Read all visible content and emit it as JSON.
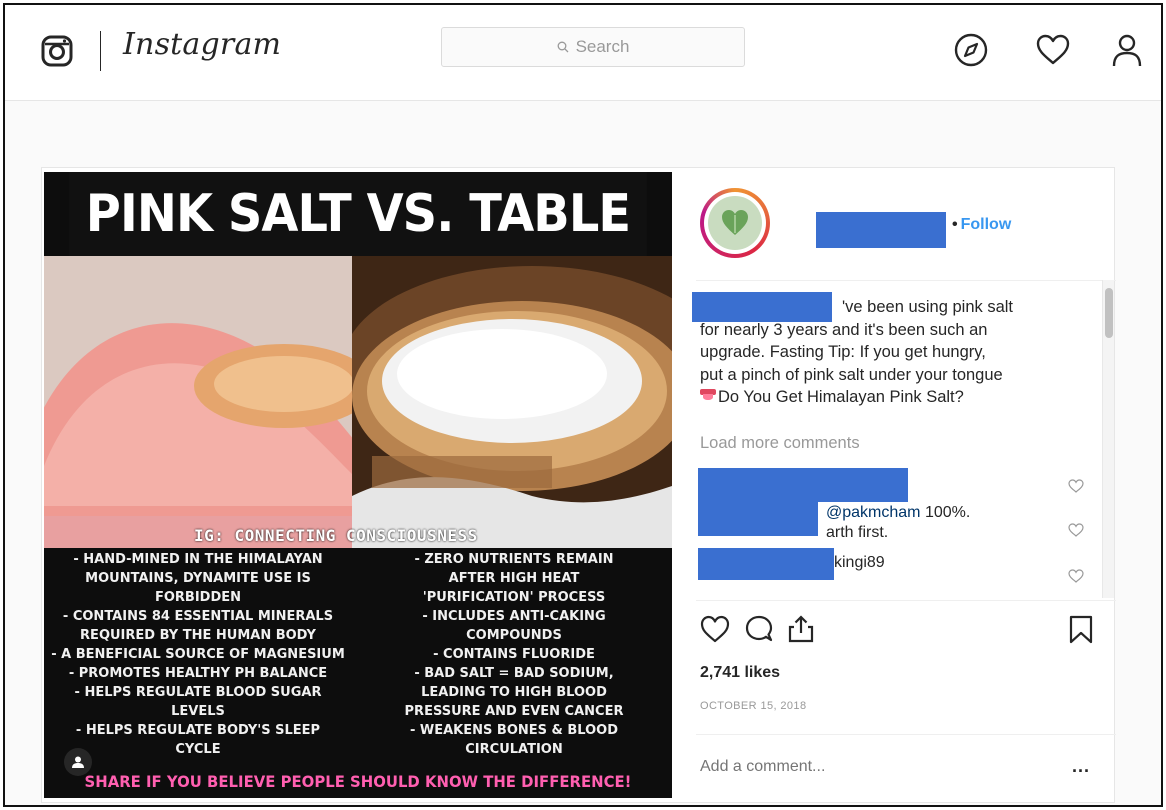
{
  "header": {
    "wordmark": "Instagram",
    "search_placeholder": "Search",
    "icons": [
      "instagram-glyph-icon",
      "compass-icon",
      "heart-icon",
      "profile-icon"
    ]
  },
  "post": {
    "image": {
      "title": "PINK SALT VS. TABLE SALT",
      "credit": "IG: CONNECTING CONSCIOUSNESS",
      "left_points": "- HAND-MINED IN THE HIMALAYAN\nMOUNTAINS, DYNAMITE USE IS\nFORBIDDEN\n- CONTAINS 84 ESSENTIAL MINERALS\nREQUIRED BY THE HUMAN BODY\n- A BENEFICIAL SOURCE OF MAGNESIUM\n- PROMOTES HEALTHY PH BALANCE\n- HELPS REGULATE BLOOD SUGAR\nLEVELS\n- HELPS REGULATE BODY'S SLEEP\nCYCLE",
      "right_points": "- ZERO NUTRIENTS REMAIN\nAFTER HIGH HEAT\n'PURIFICATION' PROCESS\n- INCLUDES ANTI-CAKING\nCOMPOUNDS\n- CONTAINS FLUORIDE\n- BAD SALT = BAD SODIUM,\nLEADING TO HIGH BLOOD\nPRESSURE AND EVEN CANCER\n- WEAKENS BONES & BLOOD\nCIRCULATION",
      "call_to_action": "SHARE IF YOU BELIEVE PEOPLE SHOULD KNOW THE DIFFERENCE!"
    },
    "follow_label": "Follow",
    "caption_lines": [
      "'ve been using pink salt",
      "for nearly 3 years and it's been such an",
      "upgrade. Fasting Tip: If you get hungry,",
      "put a pinch of pink salt under your tongue",
      "Do You Get Himalayan Pink Salt?"
    ],
    "load_more": "Load more comments",
    "comments": [
      {
        "mention": "@pakmcham",
        "text": " 100%."
      },
      {
        "text": "arth first."
      },
      {
        "text": "kingi89"
      }
    ],
    "likes": "2,741 likes",
    "date": "OCTOBER 15, 2018",
    "add_comment_placeholder": "Add a comment...",
    "more_label": "...",
    "colors": {
      "link": "#3897f0",
      "redaction": "#3a6fd0",
      "cta_pink": "#ff5fb0"
    }
  }
}
